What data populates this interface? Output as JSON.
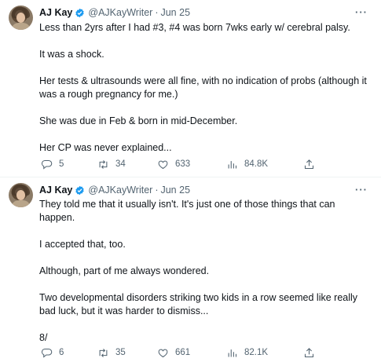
{
  "tweets": [
    {
      "author": {
        "name": "AJ Kay",
        "handle": "@AJKayWriter",
        "date": "Jun 25"
      },
      "paragraphs": [
        "Less than 2yrs after I had #3, #4 was born 7wks early w/ cerebral palsy.",
        "It was a shock.",
        "Her tests & ultrasounds were all fine, with no indication of probs (although it was a rough pregnancy for me.)",
        "She was due in Feb & born in mid-December.",
        "Her CP was never explained..."
      ],
      "stats": {
        "replies": "5",
        "retweets": "34",
        "likes": "633",
        "views": "84.8K"
      }
    },
    {
      "author": {
        "name": "AJ Kay",
        "handle": "@AJKayWriter",
        "date": "Jun 25"
      },
      "paragraphs": [
        "They told me that it usually isn't.  It's just one of those things that can happen.",
        "I accepted that, too.",
        "Although, part of me always wondered.",
        "Two developmental disorders striking two kids in a row seemed like really bad luck, but it was harder to dismiss...",
        "8/"
      ],
      "stats": {
        "replies": "6",
        "retweets": "35",
        "likes": "661",
        "views": "82.1K"
      }
    }
  ],
  "ui": {
    "more_glyph": "···",
    "separator": "·"
  },
  "icons": [
    "avatar",
    "verified-badge-icon",
    "more-options-icon",
    "reply-icon",
    "retweet-icon",
    "like-icon",
    "views-icon",
    "share-icon"
  ],
  "colors": {
    "text": "#0f1419",
    "muted": "#536471",
    "verified": "#1d9bf0",
    "divider": "#eff3f4"
  }
}
